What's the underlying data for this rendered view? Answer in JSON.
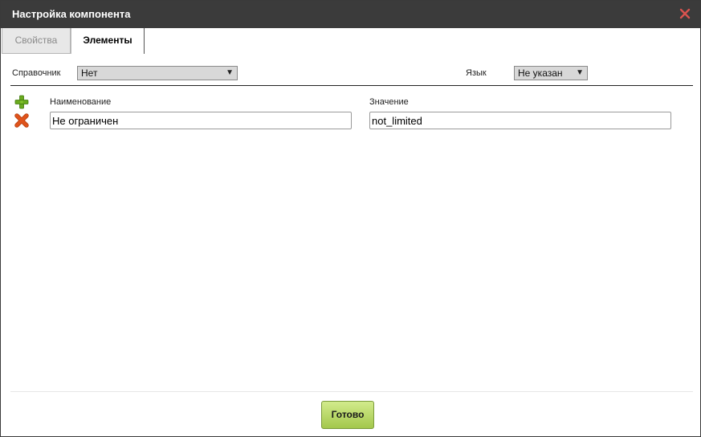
{
  "dialog": {
    "title": "Настройка компонента",
    "close_icon": "close-icon"
  },
  "tabs": [
    {
      "label": "Свойства",
      "active": false
    },
    {
      "label": "Элементы",
      "active": true
    }
  ],
  "filters": {
    "directory_label": "Справочник",
    "directory_value": "Нет",
    "language_label": "Язык",
    "language_value": "Не указан"
  },
  "table": {
    "add_icon": "plus-icon",
    "columns": [
      "Наименование",
      "Значение"
    ],
    "rows": [
      {
        "name": "Не ограничен",
        "value": "not_limited",
        "delete_icon": "delete-icon"
      }
    ]
  },
  "footer": {
    "done_label": "Готово"
  },
  "colors": {
    "titlebar": "#3b3b3b",
    "close": "#d9534f",
    "add": "#6aaa1e",
    "delete": "#e0541c",
    "done_button": "#b5d66a"
  }
}
